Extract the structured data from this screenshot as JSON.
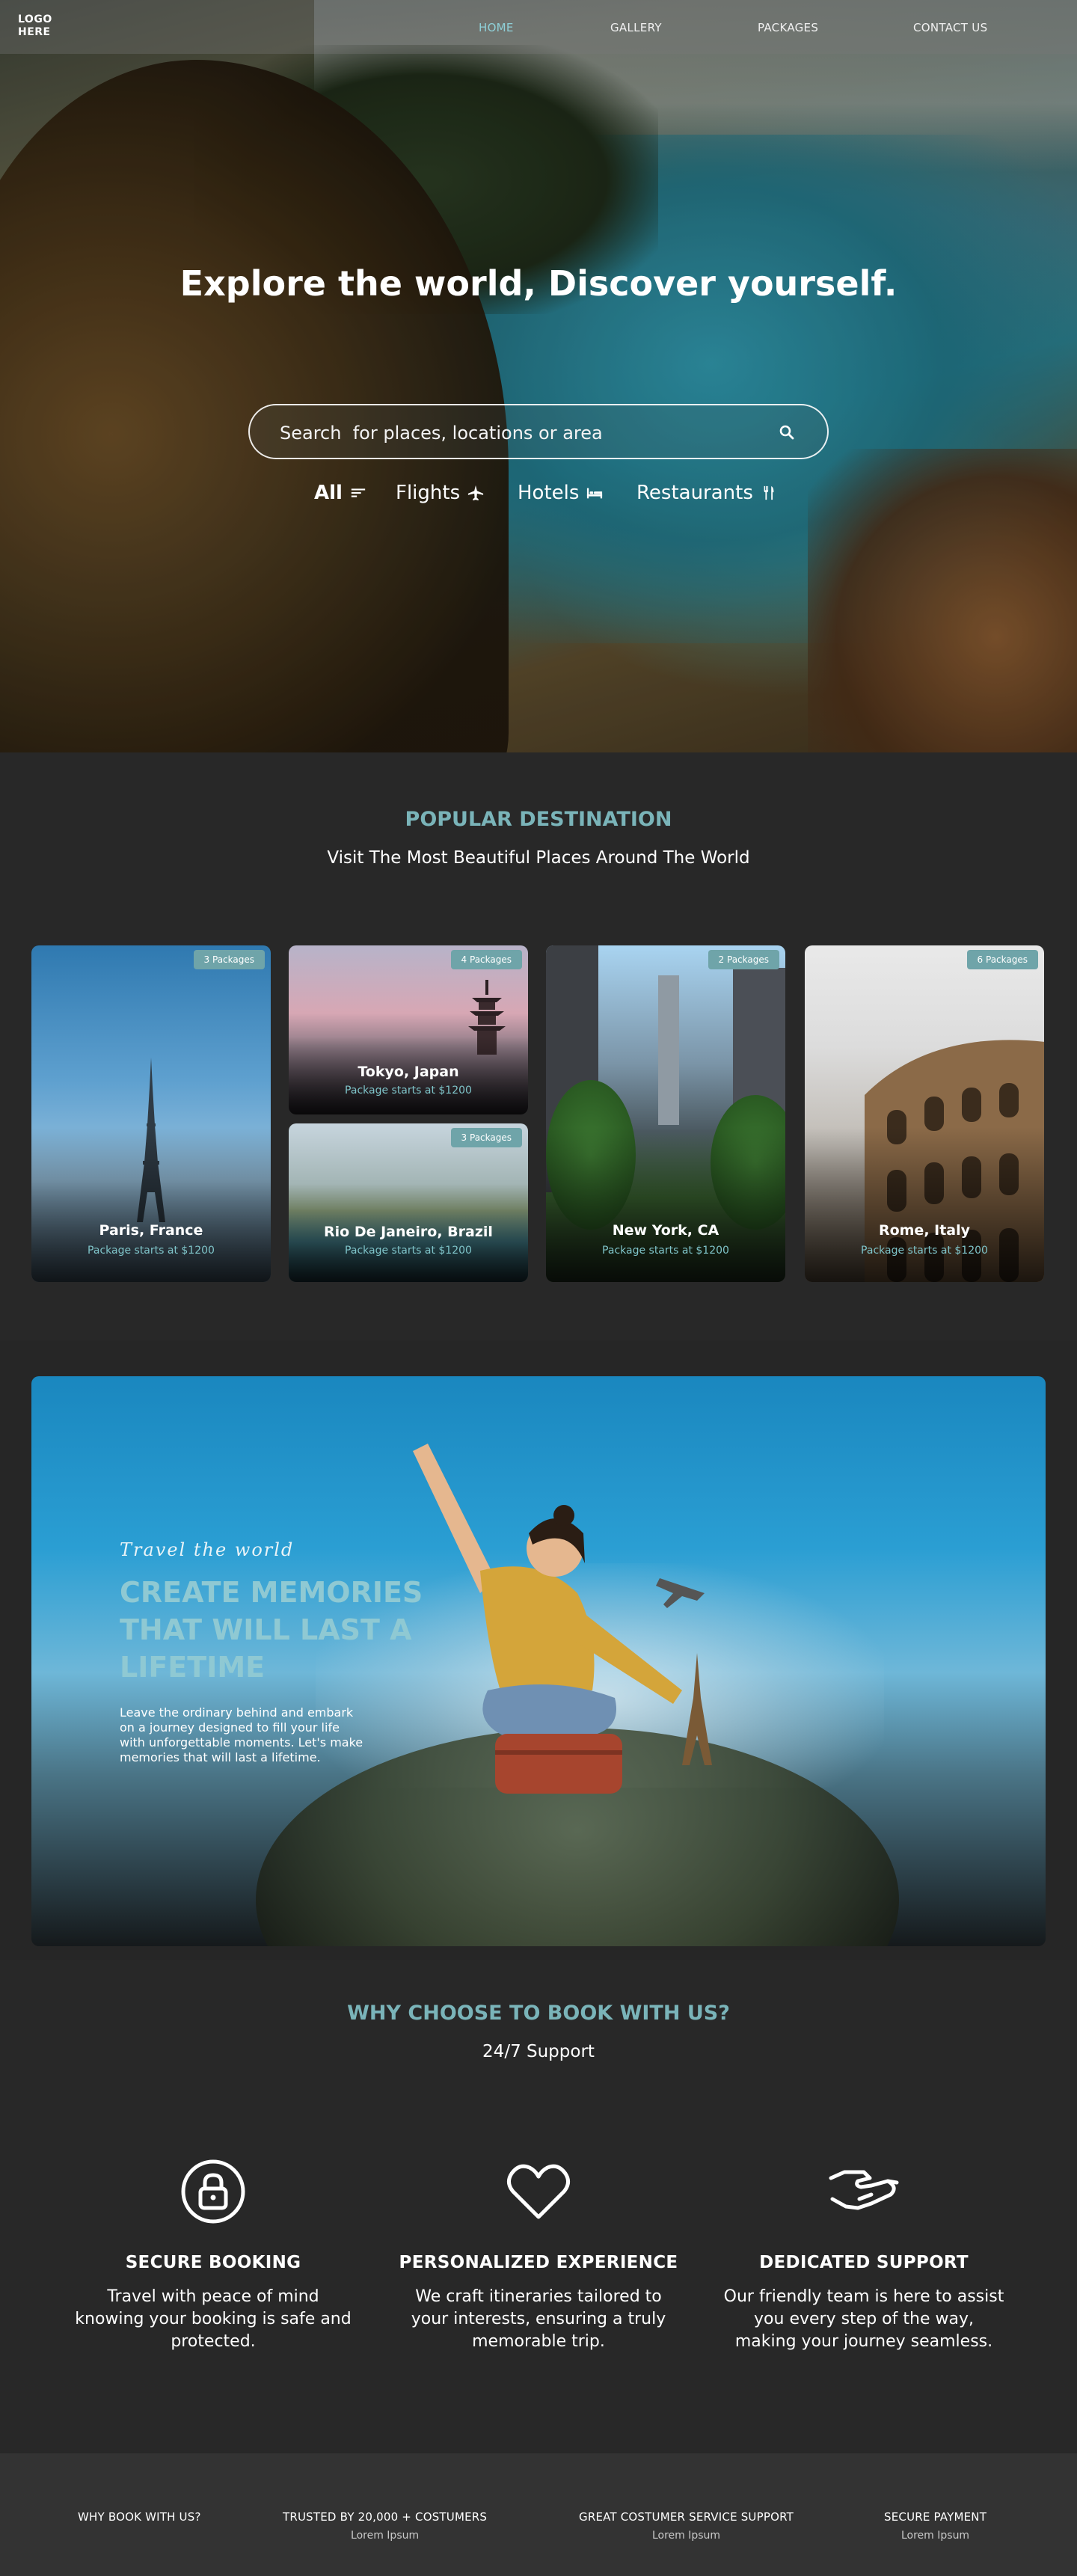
{
  "nav": {
    "logo": "LOGO\nHERE",
    "links": [
      {
        "label": "HOME",
        "active": true
      },
      {
        "label": "GALLERY",
        "active": false
      },
      {
        "label": "PACKAGES",
        "active": false
      },
      {
        "label": "CONTACT US",
        "active": false
      }
    ]
  },
  "hero": {
    "title": "Explore the world, Discover yourself.",
    "search_placeholder": "Search  for places, locations or area",
    "categories": [
      {
        "label": "All",
        "icon": "filter-icon"
      },
      {
        "label": "Flights",
        "icon": "airplane-icon"
      },
      {
        "label": "Hotels",
        "icon": "bed-icon"
      },
      {
        "label": "Restaurants",
        "icon": "utensils-icon"
      }
    ]
  },
  "popular": {
    "eyebrow": "POPULAR DESTINATION",
    "subtitle": "Visit The Most Beautiful Places Around The World",
    "cards": [
      {
        "badge": "3 Packages",
        "name": "Paris, France",
        "price": "Package starts at $1200"
      },
      {
        "badge": "4 Packages",
        "name": "Tokyo, Japan",
        "price": "Package starts at $1200"
      },
      {
        "badge": "3 Packages",
        "name": "Rio De Janeiro, Brazil",
        "price": "Package starts at $1200"
      },
      {
        "badge": "2 Packages",
        "name": "New York, CA",
        "price": "Package starts at $1200"
      },
      {
        "badge": "6 Packages",
        "name": "Rome, Italy",
        "price": "Package starts at $1200"
      }
    ]
  },
  "banner": {
    "script": "Travel the world",
    "title": "CREATE MEMORIES THAT WILL LAST A LIFETIME",
    "body": "Leave the ordinary behind and embark on a journey designed to fill your life with unforgettable moments. Let's make memories that will last a lifetime."
  },
  "why": {
    "eyebrow": "WHY CHOOSE TO BOOK WITH US?",
    "subtitle": "24/7 Support",
    "features": [
      {
        "icon": "lock-icon",
        "title": "SECURE BOOKING",
        "text": "Travel with peace of mind knowing your booking is safe and protected."
      },
      {
        "icon": "heart-icon",
        "title": "PERSONALIZED EXPERIENCE",
        "text": "We craft itineraries tailored to your interests, ensuring a truly memorable trip."
      },
      {
        "icon": "handshake-icon",
        "title": "DEDICATED SUPPORT",
        "text": "Our friendly team is here to assist you every step of the way, making your journey seamless."
      }
    ]
  },
  "footer": {
    "items": [
      {
        "title": "WHY BOOK WITH US?",
        "sub": ""
      },
      {
        "title": "TRUSTED BY 20,000 + COSTUMERS",
        "sub": "Lorem Ipsum"
      },
      {
        "title": "GREAT COSTUMER SERVICE SUPPORT",
        "sub": "Lorem Ipsum"
      },
      {
        "title": "SECURE PAYMENT",
        "sub": "Lorem Ipsum"
      }
    ]
  },
  "colors": {
    "accent": "#7ab4b9",
    "nav_active": "#8fd0d8",
    "badge": "#6fa4a9",
    "background": "#282828",
    "footer_bg": "#333333"
  }
}
